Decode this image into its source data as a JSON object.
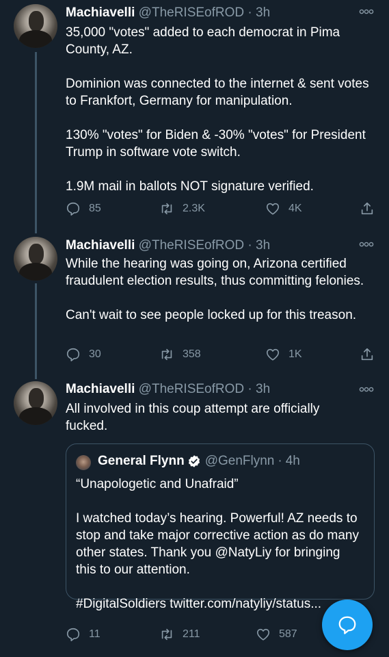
{
  "tweets": [
    {
      "author": {
        "name": "Machiavelli",
        "handle": "@TheRISEofROD",
        "separator": "·",
        "time": "3h"
      },
      "paragraphs": [
        "35,000 \"votes\" added to each democrat in Pima County, AZ.",
        "Dominion was connected to the internet & sent votes to Frankfort, Germany for manipulation.",
        "130% \"votes\" for Biden & -30% \"votes\" for President Trump in software vote switch.",
        "1.9M mail in ballots NOT signature verified."
      ],
      "stats": {
        "replies": "85",
        "retweets": "2.3K",
        "likes": "4K"
      }
    },
    {
      "author": {
        "name": "Machiavelli",
        "handle": "@TheRISEofROD",
        "separator": "·",
        "time": "3h"
      },
      "paragraphs": [
        "While the hearing was going on, Arizona certified fraudulent election results, thus committing felonies.",
        "Can't wait to see people locked up for this treason."
      ],
      "stats": {
        "replies": "30",
        "retweets": "358",
        "likes": "1K"
      }
    },
    {
      "author": {
        "name": "Machiavelli",
        "handle": "@TheRISEofROD",
        "separator": "·",
        "time": "3h"
      },
      "paragraphs": [
        "All involved in this coup attempt are officially fucked."
      ],
      "quoted": {
        "author": {
          "name": "General Flynn",
          "handle": "@GenFlynn",
          "separator": "·",
          "time": "4h"
        },
        "title": "“Unapologetic and Unafraid”",
        "paragraphs": [
          "I watched today’s hearing. Powerful! AZ needs to stop and take major corrective action as do many other states. Thank you @NatyLiy for bringing this to our attention.",
          "#DigitalSoldiers twitter.com/natyliy/status..."
        ]
      },
      "stats": {
        "replies": "11",
        "retweets": "211",
        "likes": "587"
      }
    }
  ],
  "icons": {
    "reply": "reply-icon",
    "retweet": "retweet-icon",
    "like": "heart-icon",
    "share": "share-icon",
    "more": "more-options-icon",
    "verified": "verified-badge-icon",
    "compose": "new-message-icon"
  },
  "colors": {
    "background": "#15202b",
    "secondary_text": "#8899a6",
    "thread_line": "#3d5466",
    "accent": "#1da1f2"
  }
}
